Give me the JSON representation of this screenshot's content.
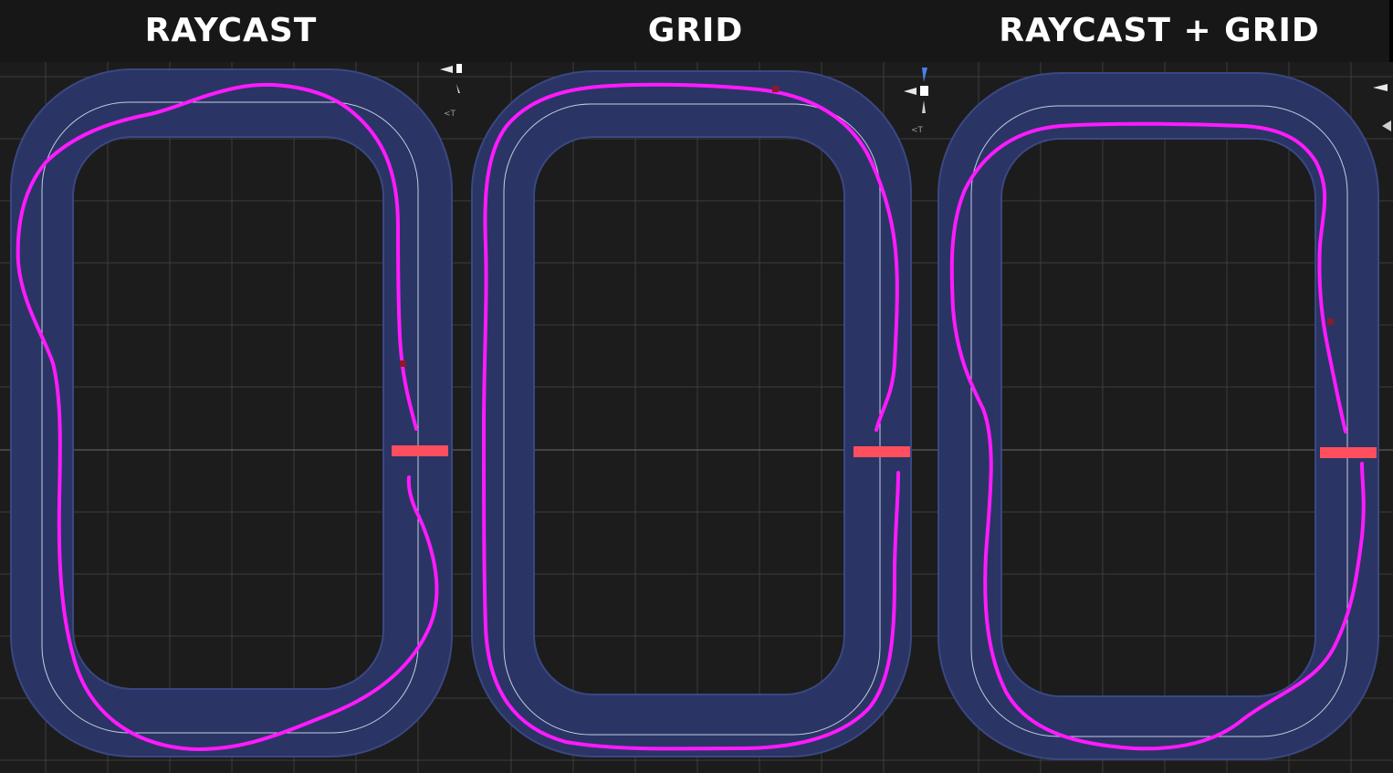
{
  "header": {
    "panels": [
      {
        "title": "RAYCAST"
      },
      {
        "title": "GRID"
      },
      {
        "title": "RAYCAST + GRID"
      }
    ]
  },
  "scene": {
    "track_color": "#2a3565",
    "track_edge_color": "#3a4882",
    "path_color": "#ff1aff",
    "centerline_color": "#c8cce0",
    "finish_line_color": "#ff4f5e",
    "grid_color": "#3d3d3d",
    "background_color": "#1c1c1c"
  },
  "gizmo": {
    "label": "<T"
  }
}
